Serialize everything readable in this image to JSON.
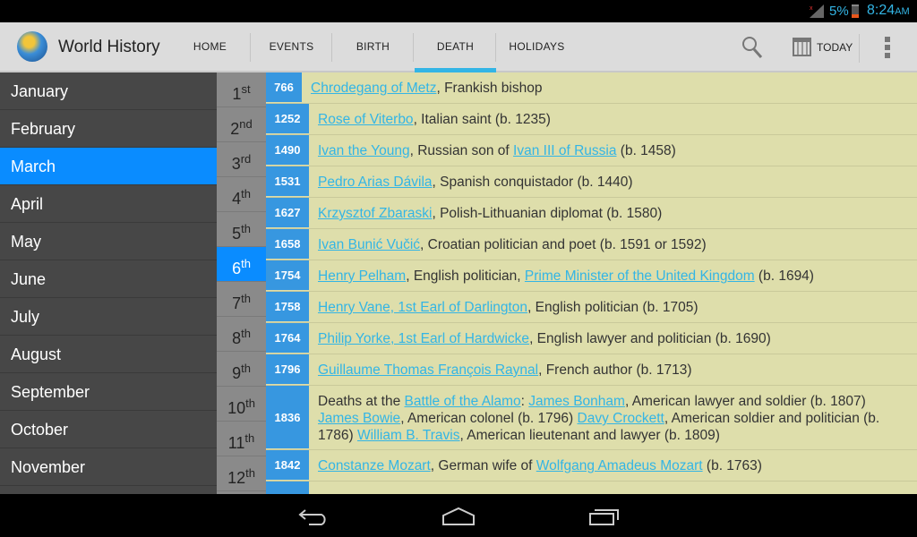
{
  "status": {
    "battery": "5%",
    "time": "8:24",
    "ampm": "AM"
  },
  "app": {
    "title": "World History",
    "tabs": [
      "HOME",
      "EVENTS",
      "BIRTH",
      "DEATH",
      "HOLIDAYS"
    ],
    "active_tab": "DEATH",
    "today": "TODAY"
  },
  "months": [
    "January",
    "February",
    "March",
    "April",
    "May",
    "June",
    "July",
    "August",
    "September",
    "October",
    "November"
  ],
  "selected_month": "March",
  "days": [
    {
      "n": "1",
      "s": "st"
    },
    {
      "n": "2",
      "s": "nd"
    },
    {
      "n": "3",
      "s": "rd"
    },
    {
      "n": "4",
      "s": "th"
    },
    {
      "n": "5",
      "s": "th"
    },
    {
      "n": "6",
      "s": "th"
    },
    {
      "n": "7",
      "s": "th"
    },
    {
      "n": "8",
      "s": "th"
    },
    {
      "n": "9",
      "s": "th"
    },
    {
      "n": "10",
      "s": "th"
    },
    {
      "n": "11",
      "s": "th"
    },
    {
      "n": "12",
      "s": "th"
    }
  ],
  "selected_day": "6",
  "entries": [
    {
      "year": "766",
      "parts": [
        {
          "t": "Chrodegang of Metz",
          "l": true
        },
        {
          "t": ", Frankish bishop"
        }
      ]
    },
    {
      "year": "1252",
      "parts": [
        {
          "t": "Rose of Viterbo",
          "l": true
        },
        {
          "t": ", Italian saint (b. 1235)"
        }
      ]
    },
    {
      "year": "1490",
      "parts": [
        {
          "t": "Ivan the Young",
          "l": true
        },
        {
          "t": ", Russian son of "
        },
        {
          "t": "Ivan III of Russia",
          "l": true
        },
        {
          "t": " (b. 1458)"
        }
      ]
    },
    {
      "year": "1531",
      "parts": [
        {
          "t": "Pedro Arias Dávila",
          "l": true
        },
        {
          "t": ", Spanish conquistador (b. 1440)"
        }
      ]
    },
    {
      "year": "1627",
      "parts": [
        {
          "t": "Krzysztof Zbaraski",
          "l": true
        },
        {
          "t": ", Polish-Lithuanian diplomat (b. 1580)"
        }
      ]
    },
    {
      "year": "1658",
      "parts": [
        {
          "t": "Ivan Bunić Vučić",
          "l": true
        },
        {
          "t": ", Croatian politician and poet (b. 1591 or 1592)"
        }
      ]
    },
    {
      "year": "1754",
      "parts": [
        {
          "t": "Henry Pelham",
          "l": true
        },
        {
          "t": ", English politician, "
        },
        {
          "t": "Prime Minister of the United Kingdom",
          "l": true
        },
        {
          "t": " (b. 1694)"
        }
      ]
    },
    {
      "year": "1758",
      "parts": [
        {
          "t": "Henry Vane, 1st Earl of Darlington",
          "l": true
        },
        {
          "t": ", English politician (b. 1705)"
        }
      ]
    },
    {
      "year": "1764",
      "parts": [
        {
          "t": "Philip Yorke, 1st Earl of Hardwicke",
          "l": true
        },
        {
          "t": ", English lawyer and politician (b. 1690)"
        }
      ]
    },
    {
      "year": "1796",
      "parts": [
        {
          "t": "Guillaume Thomas François Raynal",
          "l": true
        },
        {
          "t": ", French author (b. 1713)"
        }
      ]
    },
    {
      "year": "1836",
      "parts": [
        {
          "t": "Deaths at the "
        },
        {
          "t": "Battle of the Alamo",
          "l": true
        },
        {
          "t": ": "
        },
        {
          "t": "James Bonham",
          "l": true
        },
        {
          "t": ", American lawyer and soldier (b. 1807) "
        },
        {
          "t": "James Bowie",
          "l": true
        },
        {
          "t": ", American colonel (b. 1796) "
        },
        {
          "t": "Davy Crockett",
          "l": true
        },
        {
          "t": ", American soldier and politician (b. 1786) "
        },
        {
          "t": "William B. Travis",
          "l": true
        },
        {
          "t": ", American lieutenant and lawyer (b. 1809)"
        }
      ]
    },
    {
      "year": "1842",
      "parts": [
        {
          "t": "Constanze Mozart",
          "l": true
        },
        {
          "t": ", German wife of "
        },
        {
          "t": "Wolfgang Amadeus Mozart",
          "l": true
        },
        {
          "t": " (b. 1763)"
        }
      ]
    }
  ]
}
